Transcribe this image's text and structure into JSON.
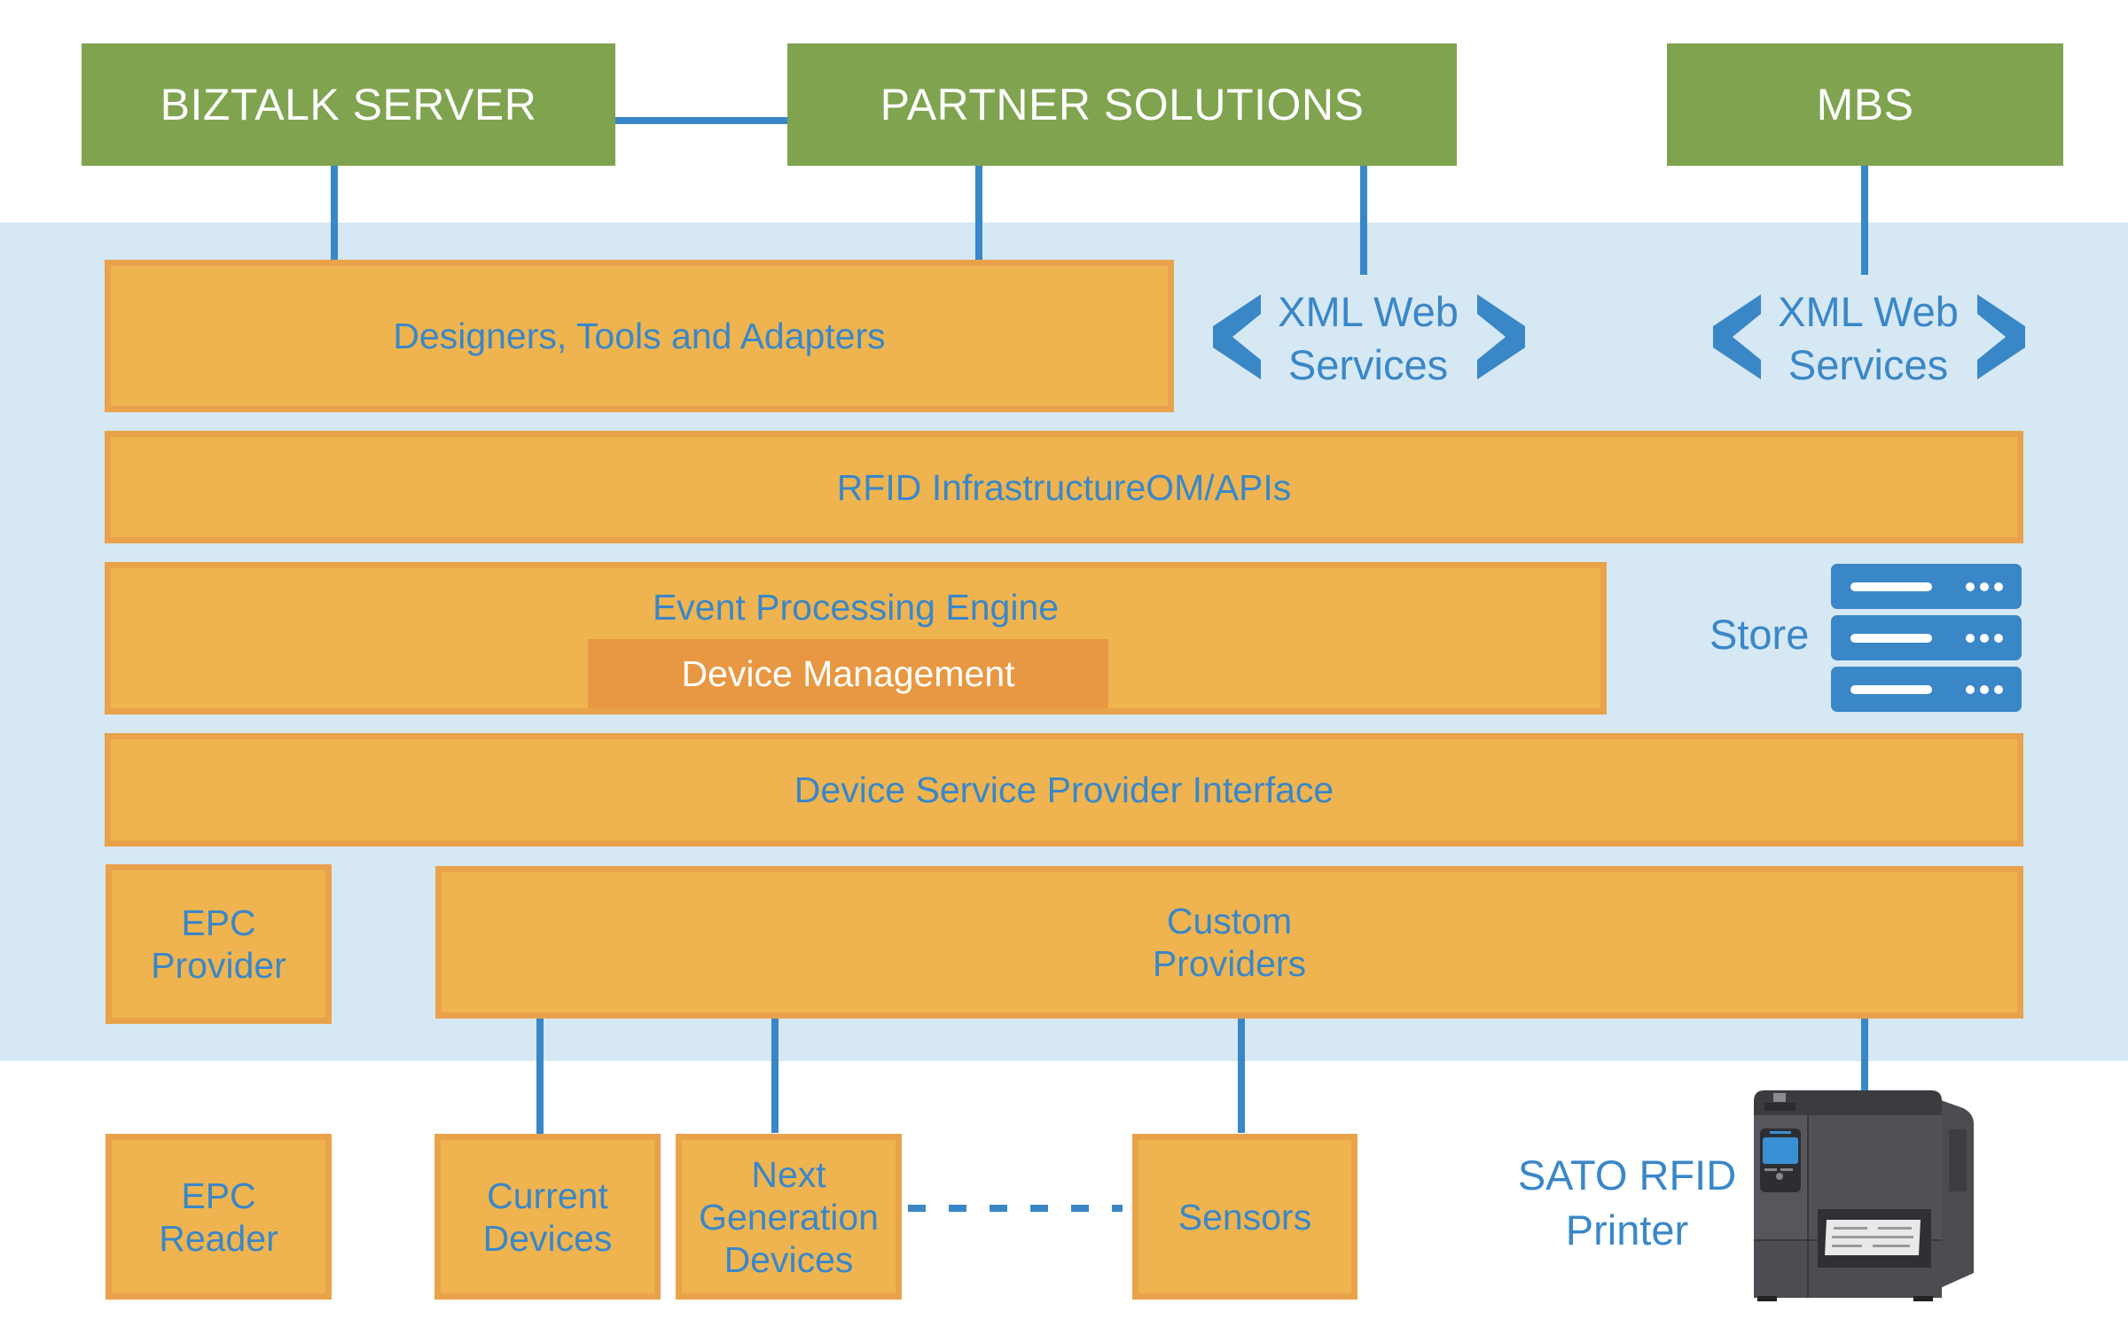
{
  "top_systems": {
    "biztalk": "BIZTALK SERVER",
    "partner": "PARTNER SOLUTIONS",
    "mbs": "MBS"
  },
  "web_services": [
    {
      "line1": "XML Web",
      "line2": "Services"
    },
    {
      "line1": "XML Web",
      "line2": "Services"
    }
  ],
  "layers": {
    "designers": "Designers, Tools and Adapters",
    "rfid_om": "RFID InfrastructureOM/APIs",
    "event_engine": "Event Processing Engine",
    "device_management": "Device Management",
    "store": "Store",
    "dspi": "Device Service Provider Interface",
    "epc_provider": [
      "EPC",
      "Provider"
    ],
    "custom_providers": [
      "Custom",
      "Providers"
    ]
  },
  "devices": {
    "epc_reader": [
      "EPC",
      "Reader"
    ],
    "current_devices": [
      "Current",
      "Devices"
    ],
    "next_generation": [
      "Next",
      "Generation",
      "Devices"
    ],
    "sensors": "Sensors",
    "printer": [
      "SATO RFID",
      "Printer"
    ]
  },
  "colors": {
    "green": "#7FA34F",
    "orange_fill": "#EFB44F",
    "orange_border": "#E9A24A",
    "device_mgmt": "#E89842",
    "blue": "#3A87C8",
    "band": "#D6E8F3"
  }
}
